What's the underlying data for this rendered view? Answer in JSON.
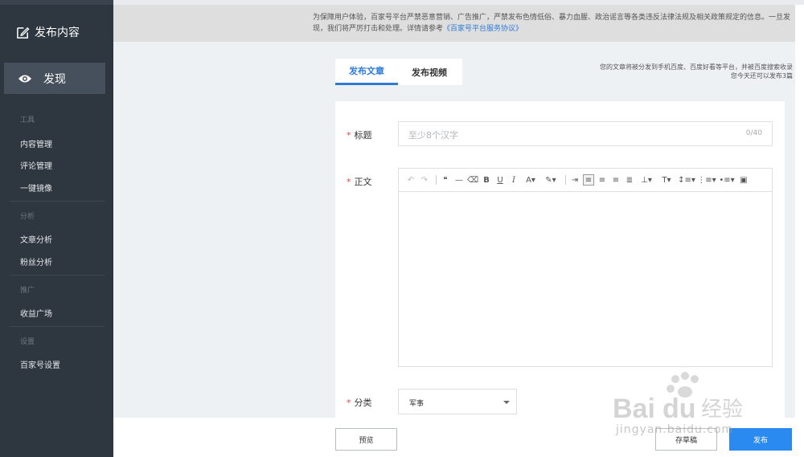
{
  "sidebar": {
    "publish_label": "发布内容",
    "discover_label": "发现",
    "groups": {
      "tools": "工具",
      "analysis": "分析",
      "promote": "推广",
      "settings": "设置"
    },
    "items": {
      "content_manage": "内容管理",
      "comment_manage": "评论管理",
      "mirror": "一键镜像",
      "article_analysis": "文章分析",
      "fans_analysis": "粉丝分析",
      "revenue_square": "收益广场",
      "account_settings": "百家号设置"
    }
  },
  "notice": {
    "text": "为保障用户体验，百家号平台严禁恶意营销、广告推广，严禁发布色情低俗、暴力血腥、政治谣言等各类违反法律法规及相关政策规定的信息。一旦发现，我们将严厉打击和处理。详情请参考",
    "link": "《百家号平台服务协议》"
  },
  "tabs": [
    {
      "label": "发布文章",
      "active": true
    },
    {
      "label": "发布视频",
      "active": false
    }
  ],
  "hint": {
    "line1": "您的文章将被分发到手机百度、百度好看等平台，并被百度搜索收录",
    "line2": "您今天还可以发布3篇"
  },
  "form": {
    "required_mark": "*",
    "title_label": "标题",
    "title_placeholder": "至少8个汉字",
    "title_count": "0/40",
    "body_label": "正文",
    "category_label": "分类",
    "category_value": "军事"
  },
  "toolbar": {
    "bold": "B",
    "underline": "U",
    "italic": "I",
    "font_color": "A"
  },
  "buttons": {
    "preview": "预览",
    "draft": "存草稿",
    "publish": "发布"
  },
  "watermark": {
    "logo": "Baidu经验",
    "url": "jingyan.baidu.com"
  },
  "colors": {
    "accent": "#2e7bd6",
    "publish_button": "#2b8af0",
    "sidebar_bg": "#2e3640",
    "required": "#e64340"
  }
}
